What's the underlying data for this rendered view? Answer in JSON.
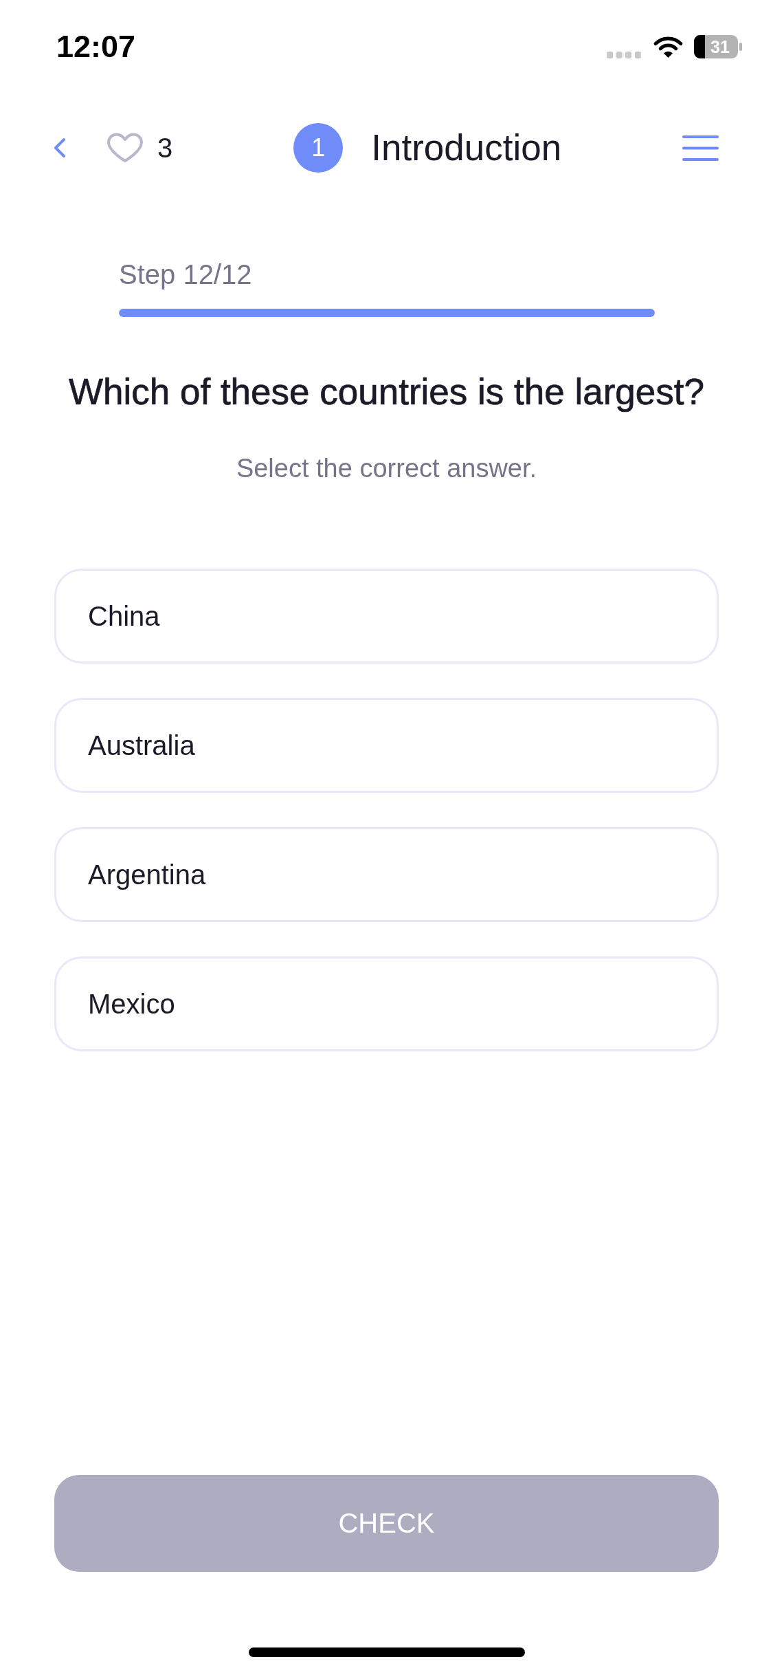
{
  "status_bar": {
    "time": "12:07",
    "battery": "31"
  },
  "header": {
    "lives": "3",
    "lesson_number": "1",
    "title": "Introduction"
  },
  "progress": {
    "label": "Step 12/12",
    "level": 1
  },
  "question": {
    "text": "Which of these countries is the largest?",
    "instruction": "Select the correct answer."
  },
  "options": [
    {
      "label": "China",
      "selected": false
    },
    {
      "label": "Australia",
      "selected": false
    },
    {
      "label": "Argentina",
      "selected": false
    },
    {
      "label": "Mexico",
      "selected": false
    }
  ],
  "check_button": {
    "label": "CHECK",
    "disabled": true
  }
}
